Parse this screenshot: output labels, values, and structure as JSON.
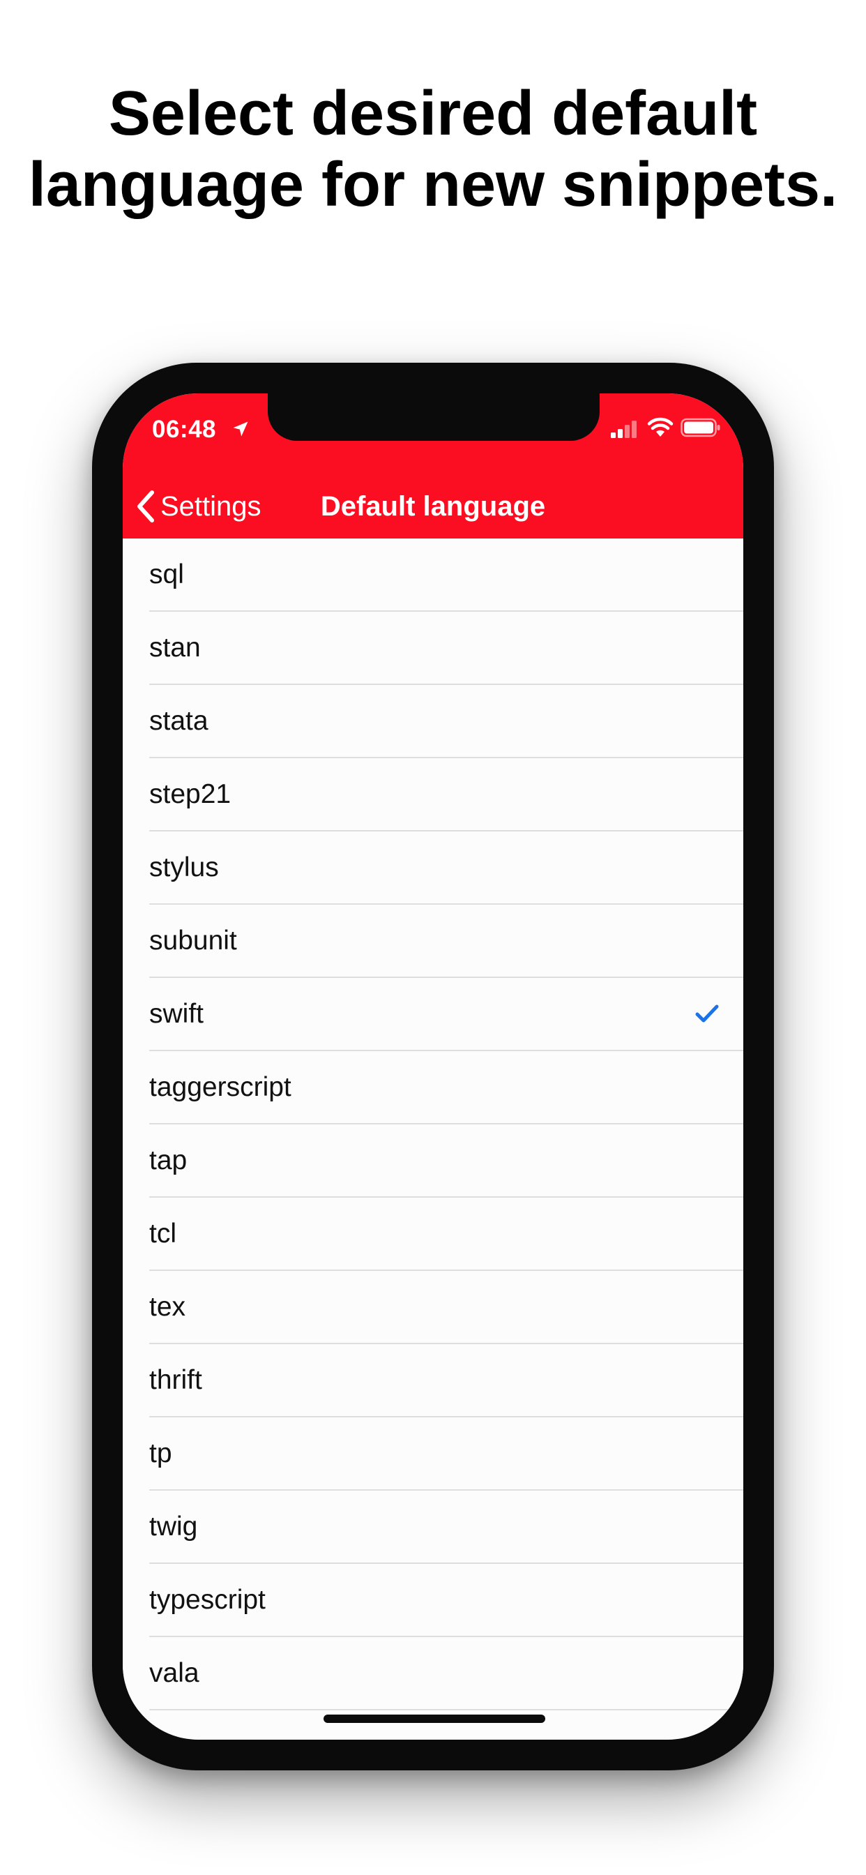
{
  "headline": {
    "line1": "Select desired default",
    "line2": "language for new snippets."
  },
  "status_bar": {
    "time": "06:48"
  },
  "nav": {
    "back_label": "Settings",
    "title": "Default language"
  },
  "languages": [
    {
      "label": "sql",
      "selected": false
    },
    {
      "label": "stan",
      "selected": false
    },
    {
      "label": "stata",
      "selected": false
    },
    {
      "label": "step21",
      "selected": false
    },
    {
      "label": "stylus",
      "selected": false
    },
    {
      "label": "subunit",
      "selected": false
    },
    {
      "label": "swift",
      "selected": true
    },
    {
      "label": "taggerscript",
      "selected": false
    },
    {
      "label": "tap",
      "selected": false
    },
    {
      "label": "tcl",
      "selected": false
    },
    {
      "label": "tex",
      "selected": false
    },
    {
      "label": "thrift",
      "selected": false
    },
    {
      "label": "tp",
      "selected": false
    },
    {
      "label": "twig",
      "selected": false
    },
    {
      "label": "typescript",
      "selected": false
    },
    {
      "label": "vala",
      "selected": false
    }
  ],
  "colors": {
    "accent": "#fb0e21",
    "checkmark": "#1a73e8"
  },
  "icons": {
    "location": "location-arrow-icon",
    "signal": "cellular-signal-icon",
    "wifi": "wifi-icon",
    "battery": "battery-icon",
    "back": "chevron-left-icon",
    "check": "checkmark-icon"
  }
}
